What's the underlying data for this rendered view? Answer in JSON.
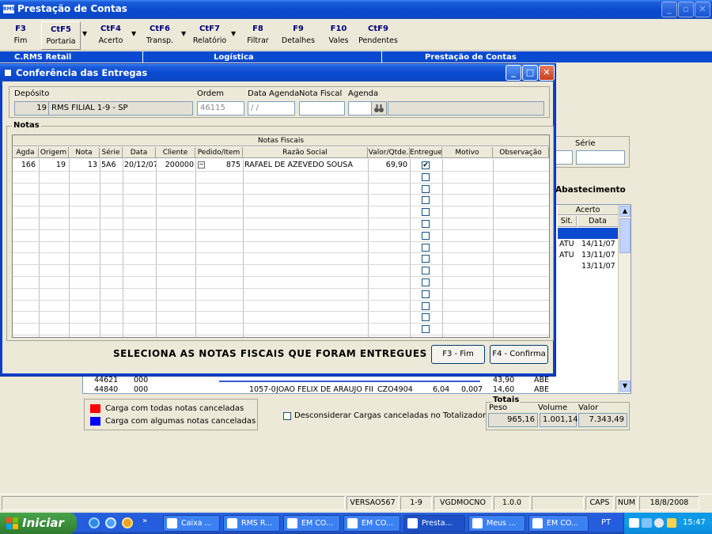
{
  "main_window": {
    "title": "Prestação de Contas",
    "icon_label": "RMS"
  },
  "toolbar": {
    "buttons": [
      {
        "key": "F3",
        "label": "Fim"
      },
      {
        "key": "CtF5",
        "label": "Portaria"
      },
      {
        "key": "CtF4",
        "label": "Acerto"
      },
      {
        "key": "CtF6",
        "label": "Transp."
      },
      {
        "key": "CtF7",
        "label": "Relatório"
      },
      {
        "key": "F8",
        "label": "Filtrar"
      },
      {
        "key": "F9",
        "label": "Detalhes"
      },
      {
        "key": "F10",
        "label": "Vales"
      },
      {
        "key": "CtF9",
        "label": "Pendentes"
      }
    ]
  },
  "bg_header": {
    "col1": "C.RMS Retail",
    "col2": "Logística",
    "col3": "Prestação de Contas"
  },
  "bg_form": {
    "serie_label": "Série",
    "abastecimento_label": "Abastecimento",
    "acerto_header": "Acerto",
    "sit_header": "Sit.",
    "data_header": "Data",
    "acerto_rows": [
      {
        "sit": "ATU",
        "data": "14/11/07"
      },
      {
        "sit": "ATU",
        "data": "13/11/07"
      },
      {
        "sit": "",
        "data": "13/11/07"
      }
    ],
    "bottom_rows": [
      {
        "c1": "44621",
        "c2": "000",
        "c3": "",
        "c4": "",
        "c5": "",
        "c6": "",
        "c7": "",
        "c8": "43,90",
        "c9": "ABE"
      },
      {
        "c1": "44840",
        "c2": "000",
        "c3": "1057-0",
        "c4": "JOAO FELIX DE ARAUJO FII",
        "c5": "CZO4904",
        "c6": "6,04",
        "c7": "0,007",
        "c8": "14,60",
        "c9": "ABE"
      }
    ],
    "legend_red": "Carga com todas notas canceladas",
    "legend_blue": "Carga com algumas notas canceladas",
    "desconsiderar_label": "Desconsiderar Cargas canceladas no Totalizador",
    "totais": {
      "title": "Totais",
      "peso_label": "Peso",
      "volume_label": "Volume",
      "valor_label": "Valor",
      "peso": "965,16",
      "volume": "1.001,141",
      "valor": "7.343,49"
    }
  },
  "dialog": {
    "title": "Conferência das Entregas",
    "deposito_label": "Depósito",
    "deposito_code": "19",
    "deposito_name": "RMS FILIAL 1-9 - SP",
    "ordem_label": "Ordem",
    "ordem_value": "46115",
    "data_agenda_label": "Data Agenda",
    "data_agenda_value": " / /",
    "nota_fiscal_label": "Nota Fiscal",
    "agenda_label": "Agenda",
    "notas_group": "Notas",
    "grid_caption": "Notas Fiscais",
    "columns": [
      "Agda",
      "Origem",
      "Nota",
      "Série",
      "Data",
      "Cliente",
      "Pedido/Item",
      "Razão Social",
      "Valor/Qtde.",
      "Entregue",
      "Motivo",
      "Observação"
    ],
    "rows": [
      {
        "agda": "166",
        "origem": "19",
        "nota": "13",
        "serie": "5A6",
        "data": "20/12/07",
        "cliente": "200000",
        "pedido": "875",
        "razao": "RAFAEL DE AZEVEDO SOUSA",
        "valor": "69,90",
        "entregue": true
      }
    ],
    "empty_row_count": 14,
    "instruction": "SELECIONA AS NOTAS FISCAIS QUE FORAM ENTREGUES",
    "btn_fim": "F3 - Fim",
    "btn_confirma": "F4 - Confirma"
  },
  "statusbar": {
    "s1": "",
    "s2": "VERSAO567",
    "s3": "1-9",
    "s4": "VGDMOCNO",
    "s5": "1.0.0",
    "s6": "",
    "caps": "CAPS",
    "num": "NUM",
    "date": "18/8/2008"
  },
  "taskbar": {
    "start_label": "Iniciar",
    "tasks": [
      "Caixa ...",
      "RMS R...",
      "EM CO...",
      "EM CO...",
      "Presta...",
      "Meus ...",
      "EM CO..."
    ],
    "lang": "PT",
    "clock": "15:47"
  },
  "colors": {
    "xp_blue": "#0a4ad0",
    "legend_red": "#ff0000",
    "legend_blue": "#0000ff",
    "selection": "#0a4ad0"
  }
}
